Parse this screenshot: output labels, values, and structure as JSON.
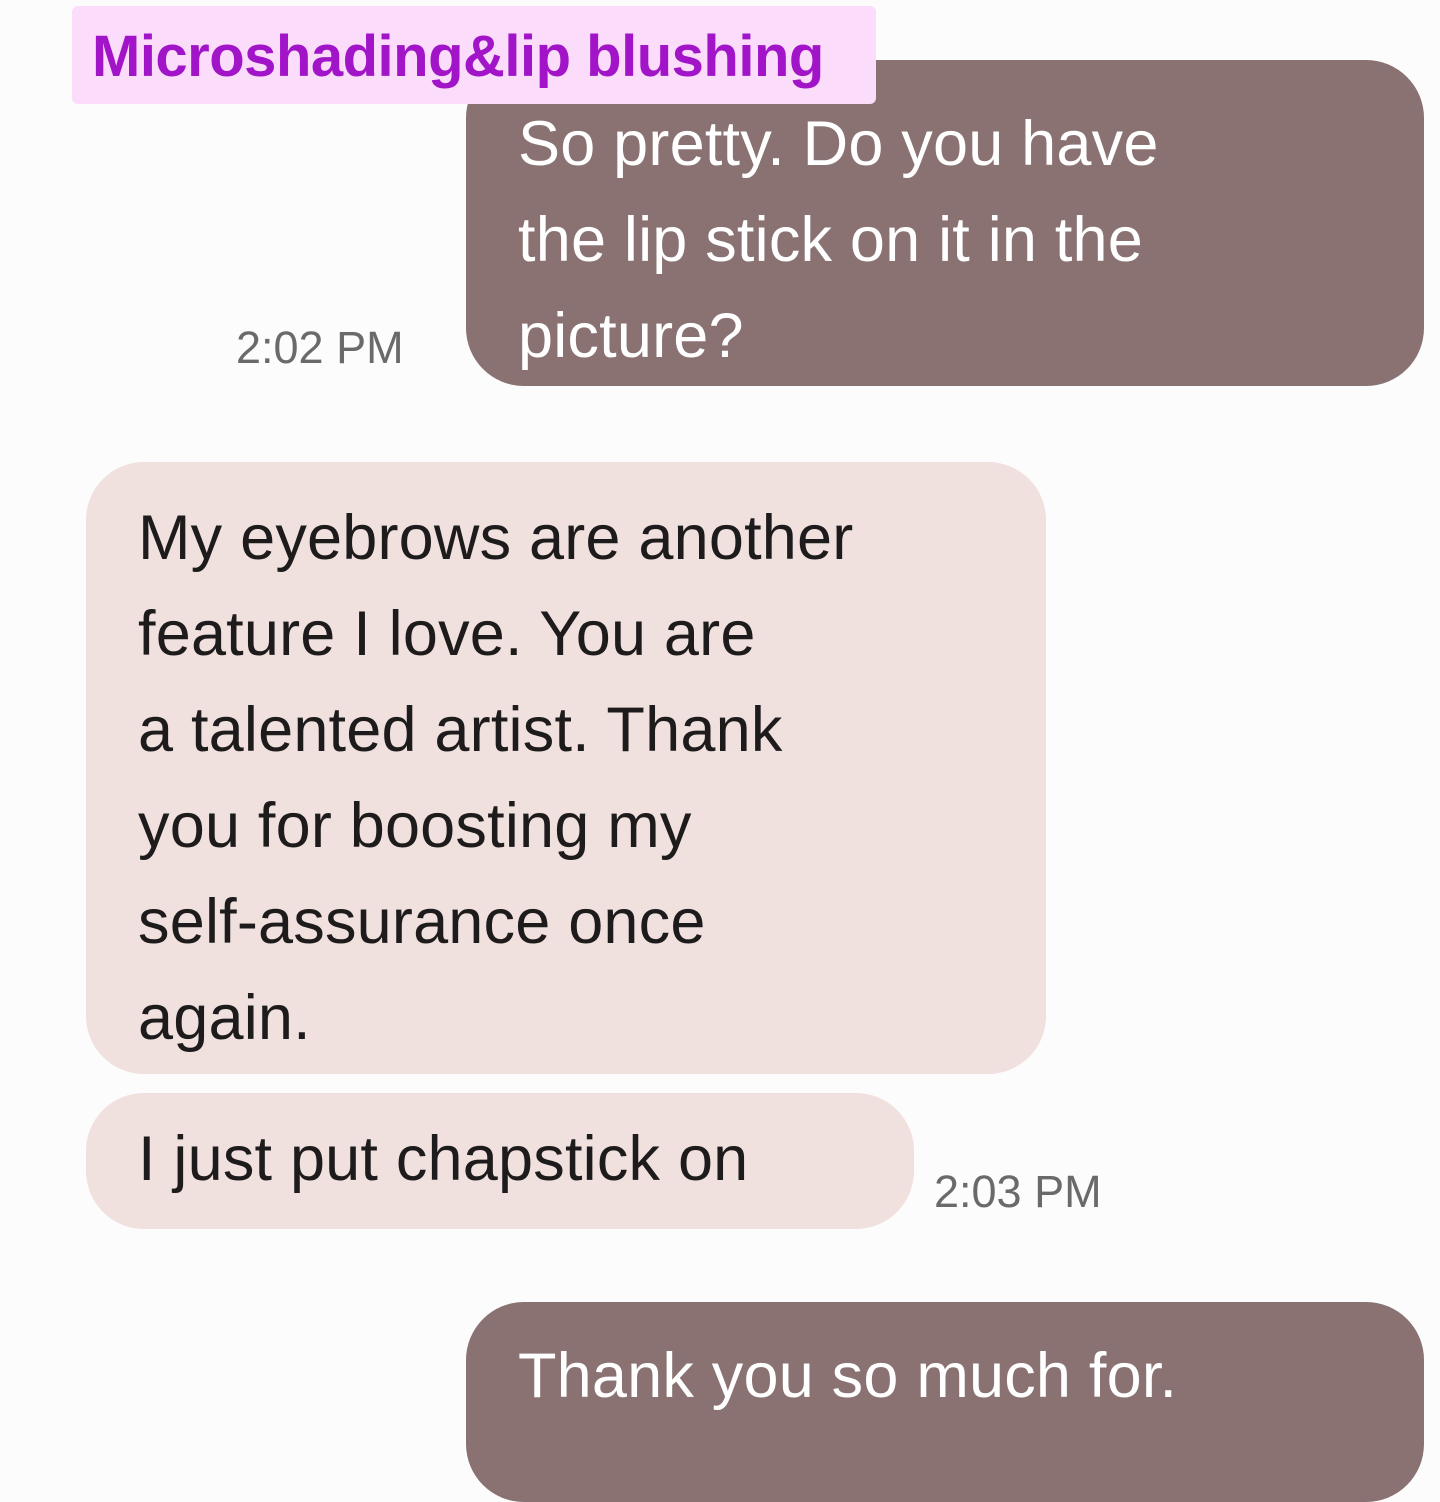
{
  "overlay": {
    "label": "Microshading&lip blushing",
    "text_color": "#a114c8",
    "background_color": "#fbdcfb"
  },
  "colors": {
    "sent_bubble": "#8a7172",
    "received_bubble": "#f0e0de",
    "background": "#fdfcfc"
  },
  "messages": [
    {
      "direction": "sent",
      "lines": [
        "So pretty.  Do you have",
        "the lip stick on it in the",
        "picture?"
      ],
      "timestamp": "2:02 PM"
    },
    {
      "direction": "received",
      "lines": [
        "My eyebrows are another",
        "feature I love. You are",
        "a talented artist. Thank",
        "you for boosting my",
        "self-assurance once",
        "again."
      ]
    },
    {
      "direction": "received",
      "lines": [
        "I just put chapstick on"
      ],
      "timestamp": "2:03 PM"
    },
    {
      "direction": "sent",
      "lines": [
        "Thank you so much for."
      ]
    }
  ]
}
